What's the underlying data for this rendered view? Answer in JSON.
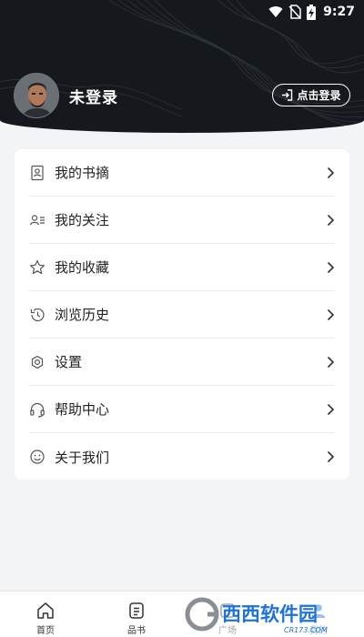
{
  "status_bar": {
    "time": "9:27",
    "icons": [
      "wifi-icon",
      "no-sim-icon",
      "battery-charging-icon"
    ]
  },
  "profile": {
    "username": "未登录",
    "avatar": "avatar-icon"
  },
  "login_button": {
    "label": "点击登录",
    "icon": "login-icon"
  },
  "menu": {
    "items": [
      {
        "label": "我的书摘",
        "icon": "book-excerpt-icon"
      },
      {
        "label": "我的关注",
        "icon": "follow-icon"
      },
      {
        "label": "我的收藏",
        "icon": "star-icon"
      },
      {
        "label": "浏览历史",
        "icon": "history-icon"
      },
      {
        "label": "设置",
        "icon": "gear-icon"
      },
      {
        "label": "帮助中心",
        "icon": "headset-icon"
      },
      {
        "label": "关于我们",
        "icon": "smile-icon"
      }
    ]
  },
  "bottom_nav": {
    "tabs": [
      {
        "label": "首页",
        "icon": "home-icon"
      },
      {
        "label": "品书",
        "icon": "book-icon"
      },
      {
        "label": "广场",
        "icon": "square-icon"
      },
      {
        "label": "我的",
        "icon": "profile-icon",
        "active": true
      }
    ],
    "active_color": "#1e73d8"
  },
  "watermark": {
    "text": "西西软件园",
    "subtext": "CR173.COM"
  },
  "colors": {
    "header_bg": "#15181d",
    "page_bg": "#f3f4f6",
    "card_bg": "#ffffff"
  }
}
